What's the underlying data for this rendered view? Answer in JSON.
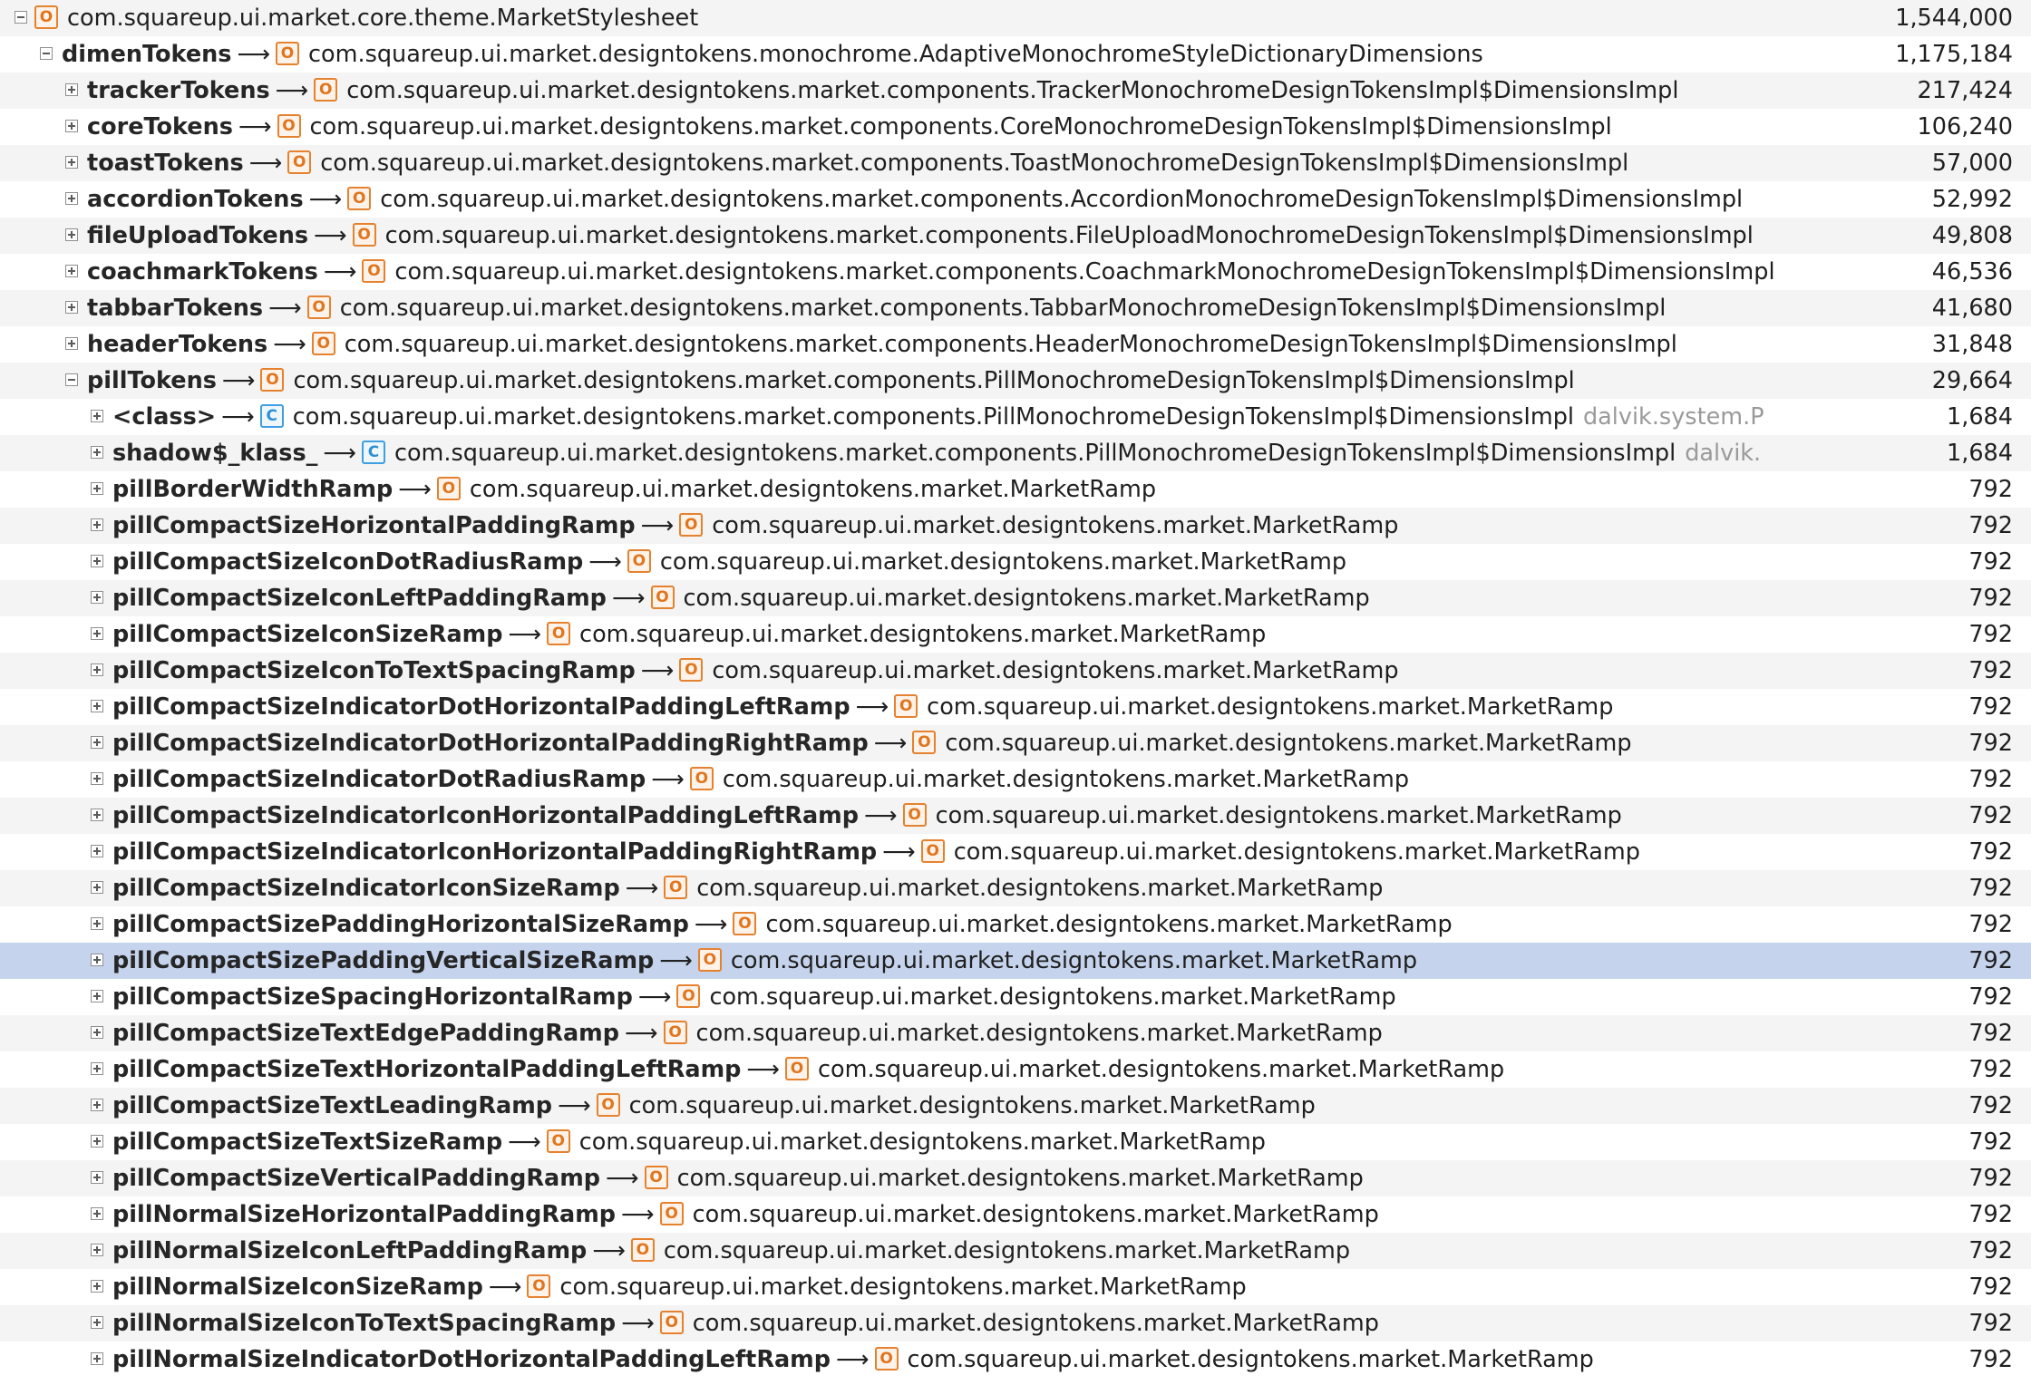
{
  "rows": [
    {
      "depth": 0,
      "expanded": true,
      "field": "",
      "badge": "O",
      "type": "com.squareup.ui.market.core.theme.MarketStylesheet",
      "extra": "",
      "size": "1,544,000"
    },
    {
      "depth": 1,
      "expanded": true,
      "field": "dimenTokens",
      "badge": "O",
      "type": "com.squareup.ui.market.designtokens.monochrome.AdaptiveMonochromeStyleDictionaryDimensions",
      "extra": "",
      "size": "1,175,184"
    },
    {
      "depth": 2,
      "expanded": false,
      "field": "trackerTokens",
      "badge": "O",
      "type": "com.squareup.ui.market.designtokens.market.components.TrackerMonochromeDesignTokensImpl$DimensionsImpl",
      "extra": "",
      "size": "217,424"
    },
    {
      "depth": 2,
      "expanded": false,
      "field": "coreTokens",
      "badge": "O",
      "type": "com.squareup.ui.market.designtokens.market.components.CoreMonochromeDesignTokensImpl$DimensionsImpl",
      "extra": "",
      "size": "106,240"
    },
    {
      "depth": 2,
      "expanded": false,
      "field": "toastTokens",
      "badge": "O",
      "type": "com.squareup.ui.market.designtokens.market.components.ToastMonochromeDesignTokensImpl$DimensionsImpl",
      "extra": "",
      "size": "57,000"
    },
    {
      "depth": 2,
      "expanded": false,
      "field": "accordionTokens",
      "badge": "O",
      "type": "com.squareup.ui.market.designtokens.market.components.AccordionMonochromeDesignTokensImpl$DimensionsImpl",
      "extra": "",
      "size": "52,992"
    },
    {
      "depth": 2,
      "expanded": false,
      "field": "fileUploadTokens",
      "badge": "O",
      "type": "com.squareup.ui.market.designtokens.market.components.FileUploadMonochromeDesignTokensImpl$DimensionsImpl",
      "extra": "",
      "size": "49,808"
    },
    {
      "depth": 2,
      "expanded": false,
      "field": "coachmarkTokens",
      "badge": "O",
      "type": "com.squareup.ui.market.designtokens.market.components.CoachmarkMonochromeDesignTokensImpl$DimensionsImpl",
      "extra": "",
      "size": "46,536"
    },
    {
      "depth": 2,
      "expanded": false,
      "field": "tabbarTokens",
      "badge": "O",
      "type": "com.squareup.ui.market.designtokens.market.components.TabbarMonochromeDesignTokensImpl$DimensionsImpl",
      "extra": "",
      "size": "41,680"
    },
    {
      "depth": 2,
      "expanded": false,
      "field": "headerTokens",
      "badge": "O",
      "type": "com.squareup.ui.market.designtokens.market.components.HeaderMonochromeDesignTokensImpl$DimensionsImpl",
      "extra": "",
      "size": "31,848"
    },
    {
      "depth": 2,
      "expanded": true,
      "field": "pillTokens",
      "badge": "O",
      "type": "com.squareup.ui.market.designtokens.market.components.PillMonochromeDesignTokensImpl$DimensionsImpl",
      "extra": "",
      "size": "29,664"
    },
    {
      "depth": 3,
      "expanded": false,
      "field": "<class>",
      "badge": "C",
      "type": "com.squareup.ui.market.designtokens.market.components.PillMonochromeDesignTokensImpl$DimensionsImpl",
      "extra": "dalvik.system.P",
      "size": "1,684"
    },
    {
      "depth": 3,
      "expanded": false,
      "field": "shadow$_klass_",
      "badge": "C",
      "type": "com.squareup.ui.market.designtokens.market.components.PillMonochromeDesignTokensImpl$DimensionsImpl",
      "extra": "dalvik.",
      "size": "1,684"
    },
    {
      "depth": 3,
      "expanded": false,
      "field": "pillBorderWidthRamp",
      "badge": "O",
      "type": "com.squareup.ui.market.designtokens.market.MarketRamp",
      "extra": "",
      "size": "792"
    },
    {
      "depth": 3,
      "expanded": false,
      "field": "pillCompactSizeHorizontalPaddingRamp",
      "badge": "O",
      "type": "com.squareup.ui.market.designtokens.market.MarketRamp",
      "extra": "",
      "size": "792"
    },
    {
      "depth": 3,
      "expanded": false,
      "field": "pillCompactSizeIconDotRadiusRamp",
      "badge": "O",
      "type": "com.squareup.ui.market.designtokens.market.MarketRamp",
      "extra": "",
      "size": "792"
    },
    {
      "depth": 3,
      "expanded": false,
      "field": "pillCompactSizeIconLeftPaddingRamp",
      "badge": "O",
      "type": "com.squareup.ui.market.designtokens.market.MarketRamp",
      "extra": "",
      "size": "792"
    },
    {
      "depth": 3,
      "expanded": false,
      "field": "pillCompactSizeIconSizeRamp",
      "badge": "O",
      "type": "com.squareup.ui.market.designtokens.market.MarketRamp",
      "extra": "",
      "size": "792"
    },
    {
      "depth": 3,
      "expanded": false,
      "field": "pillCompactSizeIconToTextSpacingRamp",
      "badge": "O",
      "type": "com.squareup.ui.market.designtokens.market.MarketRamp",
      "extra": "",
      "size": "792"
    },
    {
      "depth": 3,
      "expanded": false,
      "field": "pillCompactSizeIndicatorDotHorizontalPaddingLeftRamp",
      "badge": "O",
      "type": "com.squareup.ui.market.designtokens.market.MarketRamp",
      "extra": "",
      "size": "792"
    },
    {
      "depth": 3,
      "expanded": false,
      "field": "pillCompactSizeIndicatorDotHorizontalPaddingRightRamp",
      "badge": "O",
      "type": "com.squareup.ui.market.designtokens.market.MarketRamp",
      "extra": "",
      "size": "792"
    },
    {
      "depth": 3,
      "expanded": false,
      "field": "pillCompactSizeIndicatorDotRadiusRamp",
      "badge": "O",
      "type": "com.squareup.ui.market.designtokens.market.MarketRamp",
      "extra": "",
      "size": "792"
    },
    {
      "depth": 3,
      "expanded": false,
      "field": "pillCompactSizeIndicatorIconHorizontalPaddingLeftRamp",
      "badge": "O",
      "type": "com.squareup.ui.market.designtokens.market.MarketRamp",
      "extra": "",
      "size": "792"
    },
    {
      "depth": 3,
      "expanded": false,
      "field": "pillCompactSizeIndicatorIconHorizontalPaddingRightRamp",
      "badge": "O",
      "type": "com.squareup.ui.market.designtokens.market.MarketRamp",
      "extra": "",
      "size": "792"
    },
    {
      "depth": 3,
      "expanded": false,
      "field": "pillCompactSizeIndicatorIconSizeRamp",
      "badge": "O",
      "type": "com.squareup.ui.market.designtokens.market.MarketRamp",
      "extra": "",
      "size": "792"
    },
    {
      "depth": 3,
      "expanded": false,
      "field": "pillCompactSizePaddingHorizontalSizeRamp",
      "badge": "O",
      "type": "com.squareup.ui.market.designtokens.market.MarketRamp",
      "extra": "",
      "size": "792"
    },
    {
      "depth": 3,
      "expanded": false,
      "field": "pillCompactSizePaddingVerticalSizeRamp",
      "badge": "O",
      "type": "com.squareup.ui.market.designtokens.market.MarketRamp",
      "extra": "",
      "size": "792",
      "selected": true
    },
    {
      "depth": 3,
      "expanded": false,
      "field": "pillCompactSizeSpacingHorizontalRamp",
      "badge": "O",
      "type": "com.squareup.ui.market.designtokens.market.MarketRamp",
      "extra": "",
      "size": "792"
    },
    {
      "depth": 3,
      "expanded": false,
      "field": "pillCompactSizeTextEdgePaddingRamp",
      "badge": "O",
      "type": "com.squareup.ui.market.designtokens.market.MarketRamp",
      "extra": "",
      "size": "792"
    },
    {
      "depth": 3,
      "expanded": false,
      "field": "pillCompactSizeTextHorizontalPaddingLeftRamp",
      "badge": "O",
      "type": "com.squareup.ui.market.designtokens.market.MarketRamp",
      "extra": "",
      "size": "792"
    },
    {
      "depth": 3,
      "expanded": false,
      "field": "pillCompactSizeTextLeadingRamp",
      "badge": "O",
      "type": "com.squareup.ui.market.designtokens.market.MarketRamp",
      "extra": "",
      "size": "792"
    },
    {
      "depth": 3,
      "expanded": false,
      "field": "pillCompactSizeTextSizeRamp",
      "badge": "O",
      "type": "com.squareup.ui.market.designtokens.market.MarketRamp",
      "extra": "",
      "size": "792"
    },
    {
      "depth": 3,
      "expanded": false,
      "field": "pillCompactSizeVerticalPaddingRamp",
      "badge": "O",
      "type": "com.squareup.ui.market.designtokens.market.MarketRamp",
      "extra": "",
      "size": "792"
    },
    {
      "depth": 3,
      "expanded": false,
      "field": "pillNormalSizeHorizontalPaddingRamp",
      "badge": "O",
      "type": "com.squareup.ui.market.designtokens.market.MarketRamp",
      "extra": "",
      "size": "792"
    },
    {
      "depth": 3,
      "expanded": false,
      "field": "pillNormalSizeIconLeftPaddingRamp",
      "badge": "O",
      "type": "com.squareup.ui.market.designtokens.market.MarketRamp",
      "extra": "",
      "size": "792"
    },
    {
      "depth": 3,
      "expanded": false,
      "field": "pillNormalSizeIconSizeRamp",
      "badge": "O",
      "type": "com.squareup.ui.market.designtokens.market.MarketRamp",
      "extra": "",
      "size": "792"
    },
    {
      "depth": 3,
      "expanded": false,
      "field": "pillNormalSizeIconToTextSpacingRamp",
      "badge": "O",
      "type": "com.squareup.ui.market.designtokens.market.MarketRamp",
      "extra": "",
      "size": "792"
    },
    {
      "depth": 3,
      "expanded": false,
      "field": "pillNormalSizeIndicatorDotHorizontalPaddingLeftRamp",
      "badge": "O",
      "type": "com.squareup.ui.market.designtokens.market.MarketRamp",
      "extra": "",
      "size": "792"
    }
  ],
  "arrow_glyph": "⟶",
  "colors": {
    "selection": "#c5d4ec",
    "alt_row": "#f4f4f4",
    "object_badge": "#e5822f",
    "class_badge": "#3f9fe0"
  },
  "icons": {
    "object_badge": "object-instance-icon",
    "class_badge": "class-object-icon",
    "expand": "expand-icon",
    "collapse": "collapse-icon"
  }
}
